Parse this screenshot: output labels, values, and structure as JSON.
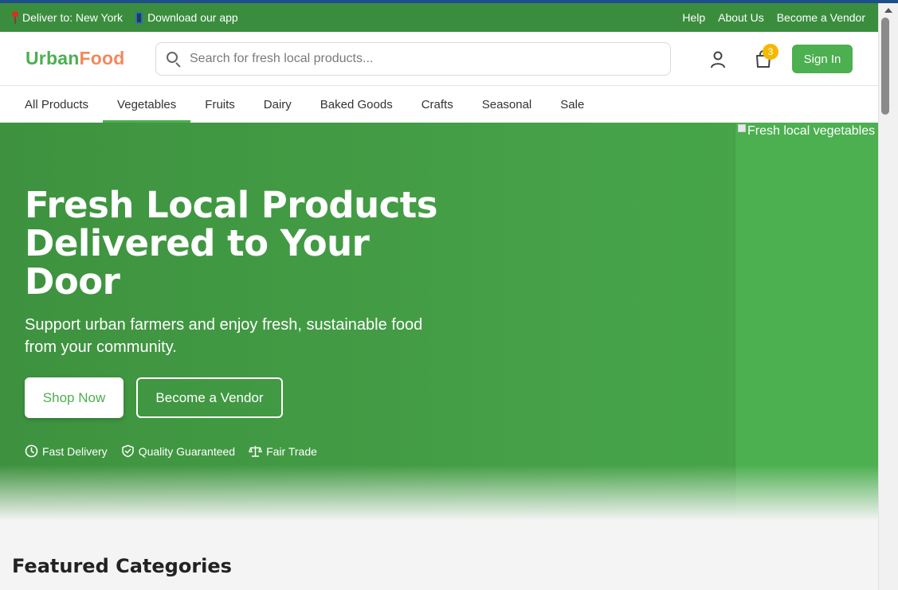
{
  "topbar": {
    "deliver": "Deliver to: New York",
    "download": "Download our app",
    "links": [
      "Help",
      "About Us",
      "Become a Vendor"
    ]
  },
  "header": {
    "logo_part1": "Urban",
    "logo_part2": "Food",
    "search_placeholder": "Search for fresh local products...",
    "cart_count": "3",
    "signin_label": "Sign In"
  },
  "nav": {
    "tabs": [
      "All Products",
      "Vegetables",
      "Fruits",
      "Dairy",
      "Baked Goods",
      "Crafts",
      "Seasonal",
      "Sale"
    ],
    "active_index": 1
  },
  "hero": {
    "image_alt": "Fresh local vegetables",
    "title": "Fresh Local Products Delivered to Your Door",
    "subtitle": "Support urban farmers and enjoy fresh, sustainable food from your community.",
    "shop_button": "Shop Now",
    "vendor_button": "Become a Vendor",
    "features": [
      "Fast Delivery",
      "Quality Guaranteed",
      "Fair Trade"
    ]
  },
  "sections": {
    "featured_title": "Featured Categories"
  },
  "colors": {
    "brand_green": "#4caf50",
    "topbar_green": "#3b8d3e",
    "logo_accent": "#f08a5d",
    "badge": "#f5b800"
  }
}
